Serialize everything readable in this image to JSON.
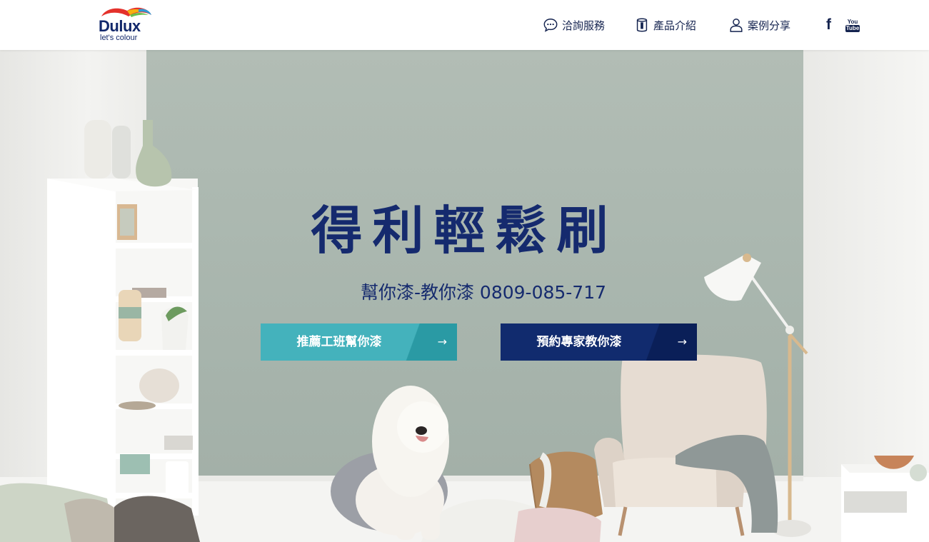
{
  "header": {
    "logo_word": "Dulux",
    "logo_tagline": "let's colour",
    "nav": [
      {
        "label": "洽詢服務",
        "icon": "chat-bubble-icon"
      },
      {
        "label": "產品介紹",
        "icon": "paint-can-icon"
      },
      {
        "label": "案例分享",
        "icon": "user-icon"
      }
    ],
    "social": {
      "facebook": "f",
      "youtube_top": "You",
      "youtube_bottom": "Tube"
    }
  },
  "hero": {
    "title": "得利輕鬆刷",
    "subtitle": "幫你漆-教你漆 0809-085-717",
    "buttons": [
      {
        "label": "推薦工班幫你漆",
        "arrow": "→",
        "color": "#44b2bc"
      },
      {
        "label": "預約專家教你漆",
        "arrow": "→",
        "color": "#112b6e"
      }
    ]
  },
  "colors": {
    "brand_navy": "#152a6e",
    "teal": "#44b2bc",
    "wall": "#aab6ae"
  }
}
